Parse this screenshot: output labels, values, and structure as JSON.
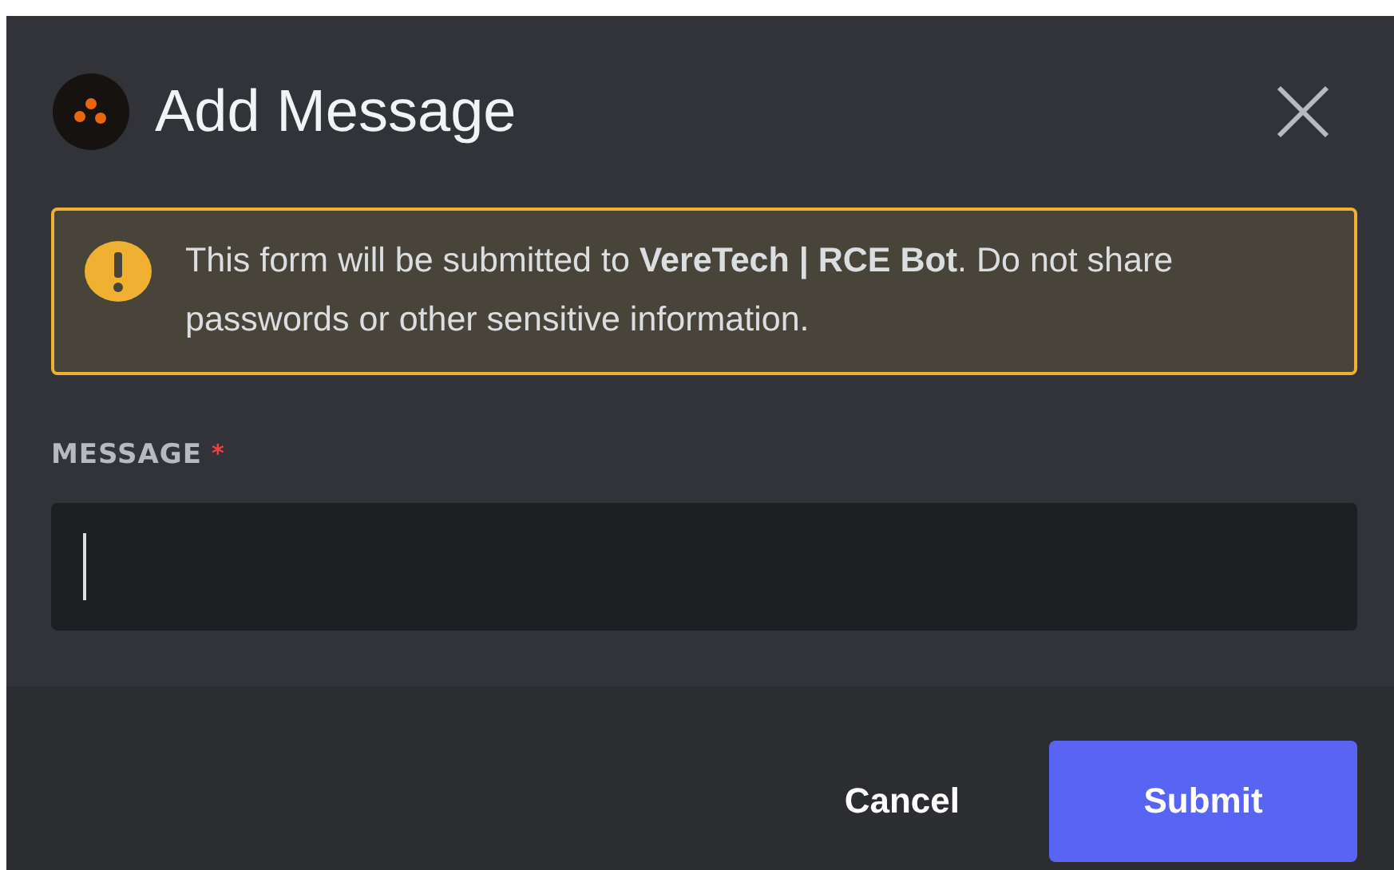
{
  "dialog": {
    "title": "Add Message",
    "notice": "This form will be submitted to **VereTech | RCE Bot**. Do not share passwords or other sensitive information.",
    "field": {
      "label": "MESSAGE",
      "required_mark": "*",
      "focused": true
    },
    "buttons": [
      {
        "label": "Cancel",
        "kind": "link"
      },
      {
        "label": "Submit",
        "kind": "primary"
      }
    ]
  }
}
